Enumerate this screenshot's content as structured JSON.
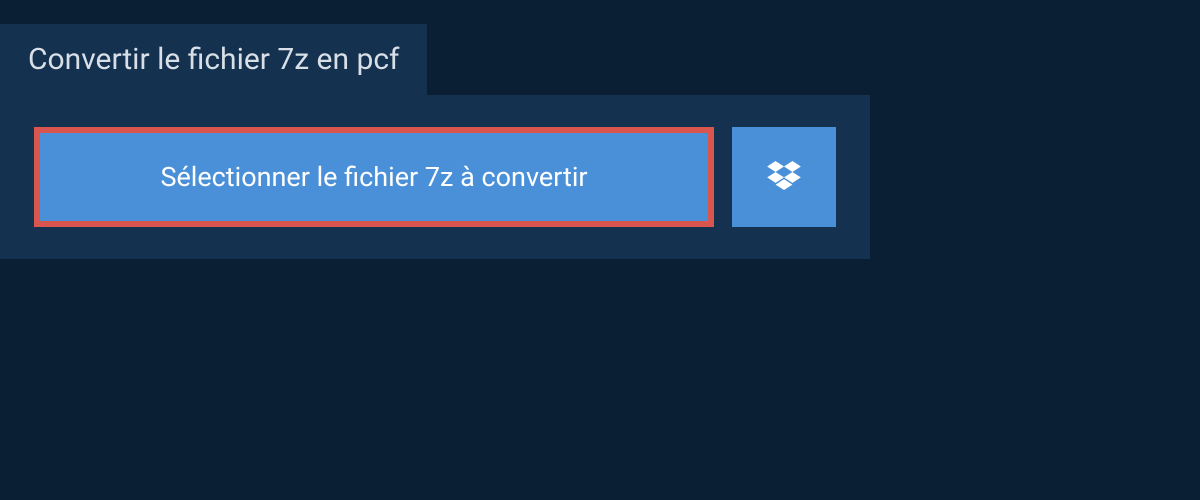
{
  "header": {
    "title": "Convertir le fichier 7z en pcf"
  },
  "actions": {
    "select_file_label": "Sélectionner le fichier 7z à convertir"
  }
}
